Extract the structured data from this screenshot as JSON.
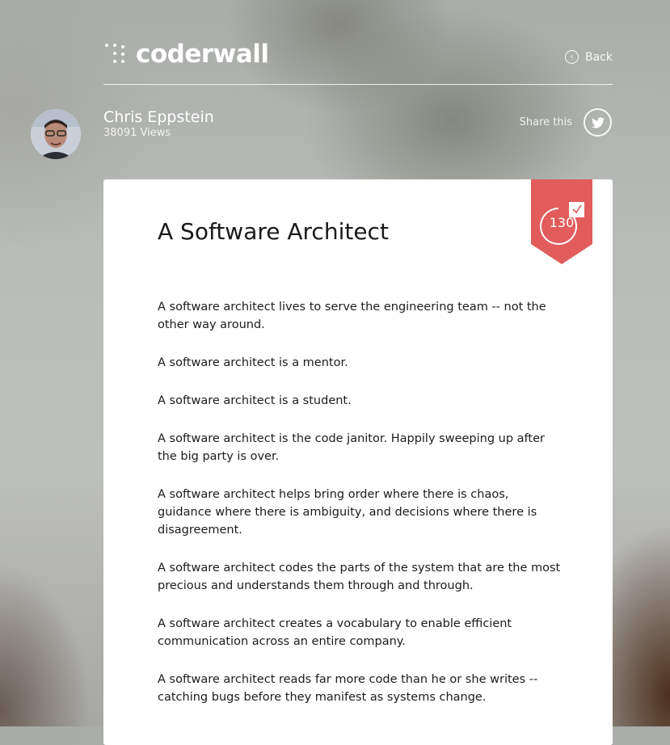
{
  "header": {
    "logo_text": "coderwall",
    "back_label": "Back"
  },
  "author": {
    "name": "Chris Eppstein",
    "views": "38091 Views"
  },
  "share": {
    "label": "Share this",
    "icon": "twitter-icon"
  },
  "protip": {
    "title": "A Software Architect",
    "upvotes": "130",
    "badge_color": "#e25c5c",
    "paragraphs": [
      "A software architect lives to serve the engineering team -- not the other way around.",
      "A software architect is a mentor.",
      "A software architect is a student.",
      "A software architect is the code janitor. Happily sweeping up after the big party is over.",
      "A software architect helps bring order where there is chaos, guidance where there is ambiguity, and decisions where there is disagreement.",
      "A software architect codes the parts of the system that are the most precious and understands them through and through.",
      "A software architect creates a vocabulary to enable efficient communication across an entire company.",
      "A software architect reads far more code than he or she writes -- catching bugs before they manifest as systems change."
    ]
  }
}
